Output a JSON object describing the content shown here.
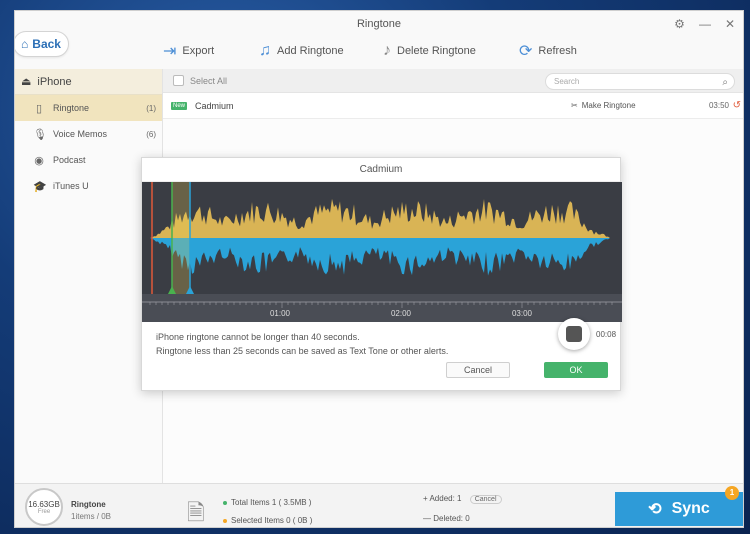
{
  "window": {
    "title": "Ringtone"
  },
  "toolbar": {
    "back_label": "Back",
    "export_label": "Export",
    "add_label": "Add Ringtone",
    "delete_label": "Delete Ringtone",
    "refresh_label": "Refresh"
  },
  "sidebar": {
    "device": "iPhone",
    "items": [
      {
        "label": "Ringtone",
        "count": "(1)",
        "icon": "phone-icon"
      },
      {
        "label": "Voice Memos",
        "count": "(6)",
        "icon": "mic-icon"
      },
      {
        "label": "Podcast",
        "count": "",
        "icon": "podcast-icon"
      },
      {
        "label": "iTunes U",
        "count": "",
        "icon": "itunes-u-icon"
      }
    ]
  },
  "list": {
    "select_all": "Select All",
    "search_placeholder": "Search",
    "rows": [
      {
        "badge": "New",
        "title": "Cadmium",
        "action": "Make Ringtone",
        "duration": "03:50"
      }
    ]
  },
  "dialog": {
    "title": "Cadmium",
    "timeline_ticks": [
      "01:00",
      "02:00",
      "03:00"
    ],
    "message_1": "iPhone ringtone cannot be longer than 40 seconds.",
    "message_2": "Ringtone less than 25 seconds can be saved as Text Tone or other alerts.",
    "record_time": "00:08",
    "cancel_label": "Cancel",
    "ok_label": "OK",
    "colors": {
      "wave_top": "#d9b455",
      "wave_bottom": "#2aa3d8",
      "background": "#3a3d44"
    }
  },
  "footer": {
    "storage_value": "16.63GB",
    "storage_label": "Free",
    "category": "Ringtone",
    "category_sub": "1items / 0B",
    "total_items": "Total Items  1  ( 3.5MB )",
    "selected_items": "Selected Items  0  ( 0B )",
    "added": "Added: 1",
    "cancel_label": "Cancel",
    "deleted": "Deleted: 0",
    "sync_label": "Sync",
    "sync_badge": "1"
  }
}
